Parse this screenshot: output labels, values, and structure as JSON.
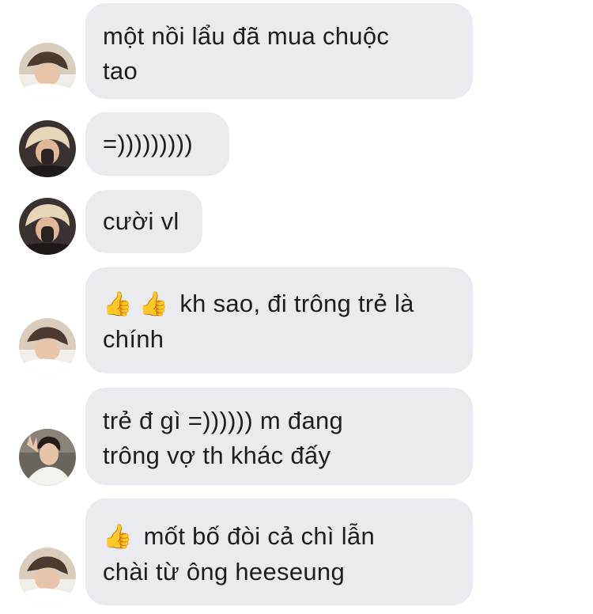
{
  "messages": [
    {
      "lines": [
        "một nồi lẩu đã mua chuộc",
        "tao"
      ],
      "emoji": [],
      "avatar": "avatar-boy-sleeping"
    },
    {
      "lines": [
        "=)))))))))"
      ],
      "emoji": [],
      "avatar": "avatar-blonde-covering-face"
    },
    {
      "lines": [
        "cười vl"
      ],
      "emoji": [],
      "avatar": "avatar-blonde-covering-face"
    },
    {
      "lines": [
        "kh sao, đi trông trẻ là",
        "chính"
      ],
      "emoji": [
        "👍",
        "👍"
      ],
      "avatar": "avatar-boy-sleeping"
    },
    {
      "lines": [
        "trẻ đ gì =)))))) m đang",
        "trông vợ th khác đấy"
      ],
      "emoji": [],
      "avatar": "avatar-man-peace-sign"
    },
    {
      "lines": [
        "mốt bố đòi cả chì lẫn",
        "chài từ ông heeseung"
      ],
      "emoji": [
        "👍"
      ],
      "avatar": "avatar-boy-sleeping"
    }
  ],
  "colors": {
    "bubble": "#e9ebee",
    "text": "#1c1e21"
  }
}
